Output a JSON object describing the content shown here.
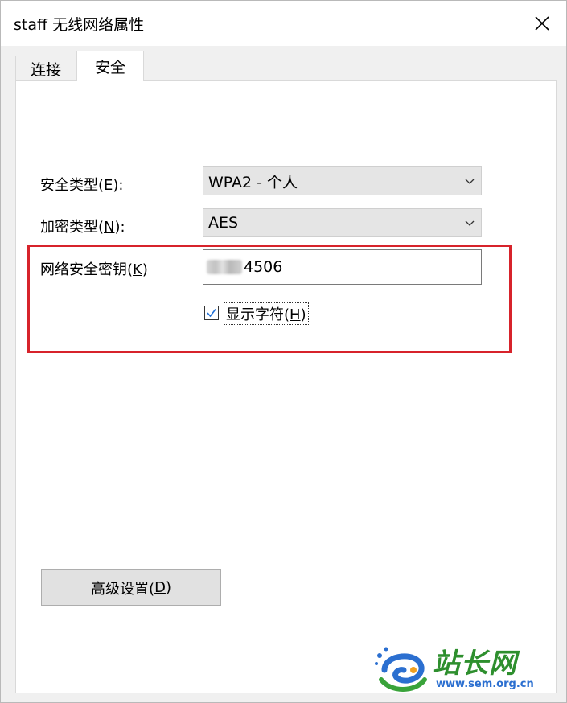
{
  "window": {
    "title": "staff 无线网络属性"
  },
  "tabs": [
    {
      "label": "连接",
      "active": false
    },
    {
      "label": "安全",
      "active": true
    }
  ],
  "security": {
    "security_type_label_pre": "安全类型(",
    "security_type_label_key": "E",
    "security_type_label_post": "):",
    "security_type_value": "WPA2 - 个人",
    "encryption_type_label_pre": "加密类型(",
    "encryption_type_label_key": "N",
    "encryption_type_label_post": "):",
    "encryption_type_value": "AES",
    "key_label_pre": "网络安全密钥(",
    "key_label_key": "K",
    "key_label_post": ")",
    "key_value_visible": "4506",
    "show_chars_checked": true,
    "show_chars_label_pre": "显示字符(",
    "show_chars_label_key": "H",
    "show_chars_label_post": ")"
  },
  "advanced_button": {
    "label_pre": "高级设置(",
    "label_key": "D",
    "label_post": ")"
  },
  "watermark": {
    "text": "站长网",
    "url": "www.sem.org.cn"
  },
  "colors": {
    "highlight": "#d7232b",
    "checkbox_check": "#1f6fd6"
  }
}
